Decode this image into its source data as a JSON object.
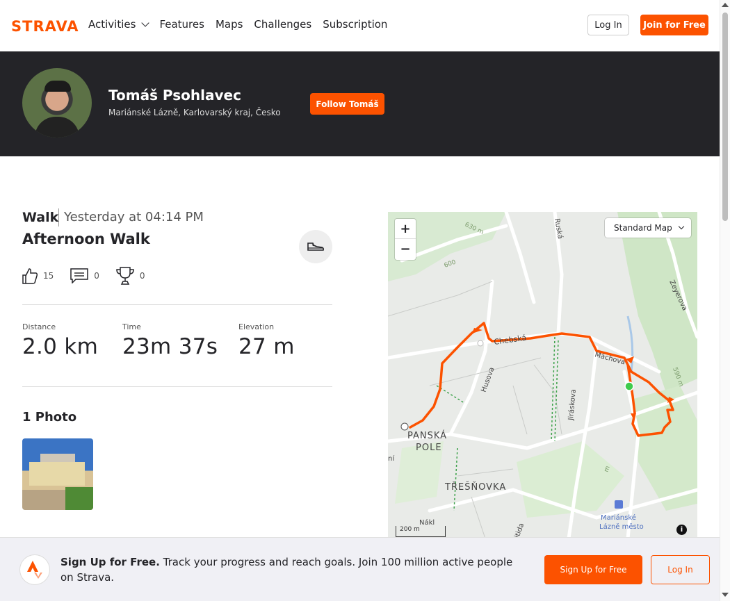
{
  "nav": {
    "logo": "STRAVA",
    "links": [
      "Activities",
      "Features",
      "Maps",
      "Challenges",
      "Subscription"
    ],
    "login": "Log In",
    "join": "Join for Free"
  },
  "athlete": {
    "name": "Tomáš Psohlavec",
    "location": "Mariánské Lázně, Karlovarský kraj, Česko",
    "follow": "Follow Tomáš"
  },
  "activity": {
    "type": "Walk",
    "date": "Yesterday at 04:14 PM",
    "title": "Afternoon Walk",
    "kudos": "15",
    "comments": "0",
    "achievements": "0",
    "stats": [
      {
        "label": "Distance",
        "value": "2.0 km"
      },
      {
        "label": "Time",
        "value": "23m 37s"
      },
      {
        "label": "Elevation",
        "value": "27 m"
      }
    ],
    "photos_title": "1 Photo"
  },
  "map": {
    "style": "Standard Map",
    "zoom_in": "+",
    "zoom_out": "−",
    "scale": "200 m",
    "labels": {
      "panska": "PANSKÁ",
      "pole": "POLE",
      "tresnovka": "TŘEŠŇOVKA",
      "chebska": "Chebská",
      "machova": "Máchova",
      "husova": "Husova",
      "jiraskova": "Jiráskova",
      "ruska": "Ruská",
      "zeyerova": "Zeyerova",
      "ml1": "Mariánské",
      "ml2": "Lázně město",
      "e630": "630 m",
      "e600": "600",
      "e590": "590 m",
      "e6": "m",
      "nak": "Nákl",
      "ni": "ní",
      "itida": "itida"
    }
  },
  "banner": {
    "bold": "Sign Up for Free.",
    "text": " Track your progress and reach goals. Join 100 million active people on Strava.",
    "signup": "Sign Up for Free",
    "login": "Log In"
  },
  "colors": {
    "brand": "#fc5200",
    "hero": "#242428",
    "route": "#fc5200",
    "start": "#3ecb4d"
  }
}
